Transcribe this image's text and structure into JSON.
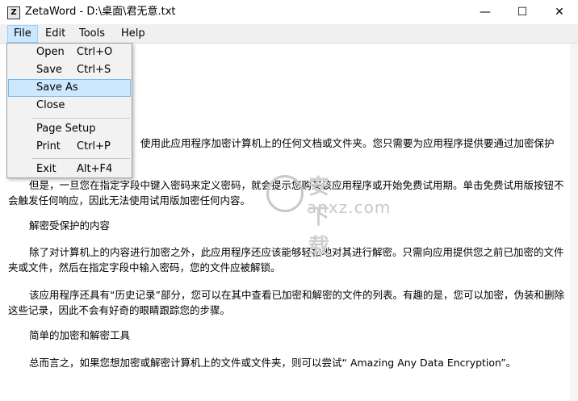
{
  "window": {
    "app_icon_letter": "Z",
    "title": "ZetaWord - D:\\桌面\\君无意.txt",
    "controls": {
      "minimize": "—",
      "maximize": "☐",
      "close": "✕"
    }
  },
  "menubar": {
    "file": "File",
    "edit": "Edit",
    "tools": "Tools",
    "help": "Help"
  },
  "file_menu": {
    "open": {
      "label": "Open",
      "shortcut": "Ctrl+O"
    },
    "save": {
      "label": "Save",
      "shortcut": "Ctrl+S"
    },
    "save_as": {
      "label": "Save As"
    },
    "close": {
      "label": "Close"
    },
    "page_setup": {
      "label": "Page Setup"
    },
    "print": {
      "label": "Print",
      "shortcut": "Ctrl+P"
    },
    "exit": {
      "label": "Exit",
      "shortcut": "Alt+F4"
    }
  },
  "document": {
    "p1": "使用此应用程序加密计算机上的任何文档或文件夹。您只需要为应用程序提供要通过加密保护",
    "p2": "但是，一旦您在指定字段中键入密码来定义密码，就会提示您购买该应用程序或开始免费试用期。单击免费试用版按钮不会触发任何响应，因此无法使用试用版加密任何内容。",
    "h1": "解密受保护的内容",
    "p3": "除了对计算机上的内容进行加密之外，此应用程序还应该能够轻松地对其进行解密。只需向应用提供您之前已加密的文件夹或文件，然后在指定字段中输入密码，您的文件应被解锁。",
    "p4": "该应用程序还具有“历史记录”部分，您可以在其中查看已加密和解密的文件的列表。有趣的是，您可以加密，伪装和删除这些记录，因此不会有好奇的眼睛跟踪您的步骤。",
    "h2": "简单的加密和解密工具",
    "p5": "总而言之，如果您想加密或解密计算机上的文件或文件夹，则可以尝试“ Amazing Any Data Encryption”。"
  },
  "watermark": {
    "title": "安下载",
    "text": "anxz.com"
  }
}
